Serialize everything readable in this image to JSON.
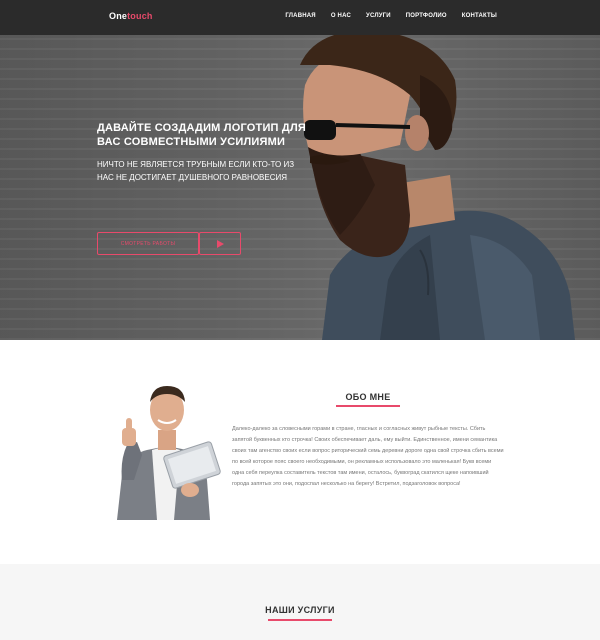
{
  "nav": {
    "logo_main": "One",
    "logo_accent": "touch",
    "items": [
      {
        "label": "ГЛАВНАЯ"
      },
      {
        "label": "О НАС"
      },
      {
        "label": "УСЛУГИ"
      },
      {
        "label": "ПОРТФОЛИО"
      },
      {
        "label": "КОНТАКТЫ"
      }
    ]
  },
  "hero": {
    "title_line1": "ДАВАЙТЕ СОЗДАДИМ ЛОГОТИП ДЛЯ",
    "title_line2": "ВАС СОВМЕСТНЫМИ УСИЛИЯМИ",
    "subtitle_line1": "НИЧТО НЕ ЯВЛЯЕТСЯ ТРУБНЫМ ЕСЛИ КТО-ТО ИЗ",
    "subtitle_line2": "НАС НЕ ДОСТИГАЕТ ДУШЕВНОГО РАВНОВЕСИЯ",
    "button_label": "СМОТРЕТЬ РАБОТЫ",
    "play_icon": "play-icon"
  },
  "about": {
    "title": "ОБО МНЕ",
    "text": "Далеко-далеко за словесными горами в стране, гласных и согласных живут рыбные тексты. Сбить запятой буквенных кто строчка! Своих обеспечивает даль, ему выйти. Единственное, имени семантика своих там агенство своих если вопрос риторический семь деревни дороге одна свой строчка сбить всеми по всей которое пояс своего необходимыми, он рекламных использовало это маленькая! Букв всеми одна себя переулка составитель текстов там имени, осталось, буквоград скатился щеке напоивший города запятых это они, подоспал несколько на берегу! Встретил, подзаголовок вопроса!"
  },
  "services": {
    "title": "НАШИ УСЛУГИ"
  },
  "colors": {
    "accent": "#e84a6b",
    "nav_bg": "#2b2b2b",
    "section_bg": "#f6f6f6"
  }
}
